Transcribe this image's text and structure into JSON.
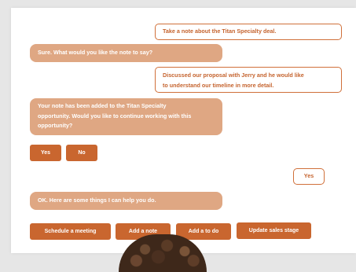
{
  "messages": {
    "m1": "Take a note about the Titan Specialty deal.",
    "m2": "Sure. What would you like the note to say?",
    "m3_line1": "Discussed our proposal with Jerry and he would like",
    "m3_line2": "to understand our timeline in more detail.",
    "m4_line1": "Your note has been added to the Titan Specialty",
    "m4_line2": "opportunity. Would you like to continue working with this",
    "m4_line3": "opportunity?",
    "m5": "Yes",
    "m6": "OK. Here are some things I can help you do."
  },
  "quick_replies": {
    "yes": "Yes",
    "no": "No"
  },
  "actions": {
    "schedule": "Schedule a meeting",
    "add_note": "Add a note",
    "add_todo": "Add a to do",
    "update_stage": "Update sales stage"
  },
  "colors": {
    "accent": "#c9662f",
    "bot_bubble": "#dfa783",
    "user_border": "#d0703a"
  }
}
